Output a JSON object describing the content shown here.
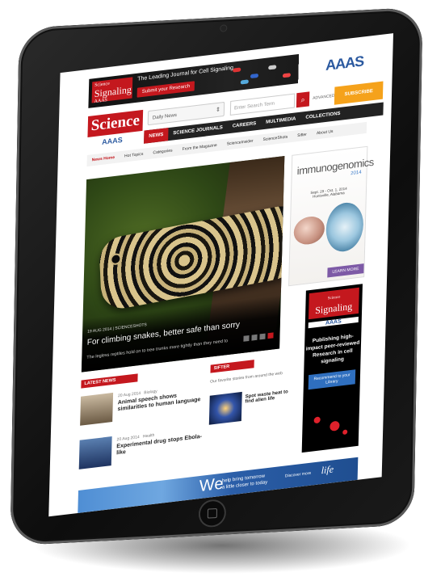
{
  "ad_top": {
    "logo_small": "Science",
    "logo": "Signaling",
    "logo_aaas": "AAAS",
    "tagline": "The Leading Journal for Cell Signaling",
    "submit": "Submit your Research",
    "brand": "AAAS"
  },
  "header": {
    "logo": "Science",
    "dropdown": "Daily News",
    "search_placeholder": "Enter Search Term",
    "advanced": "ADVANCED",
    "subscribe": "SUBSCRIBE",
    "aaas": "AAAS"
  },
  "nav": [
    "NEWS",
    "SCIENCE JOURNALS",
    "CAREERS",
    "MULTIMEDIA",
    "COLLECTIONS"
  ],
  "subnav": [
    "News Home",
    "Hot Topics",
    "Categories",
    "From the Magazine",
    "ScienceInsider",
    "ScienceShots",
    "Sifter",
    "About Us"
  ],
  "hero": {
    "date": "19 AUG 2014",
    "section": "SCIENCESHOTS",
    "title": "For climbing snakes, better safe than sorry",
    "subtitle": "The legless reptiles hold on to tree trunks more tightly than they need to"
  },
  "ad_immuno": {
    "title": "immunogenomics",
    "year": "2014",
    "dates": "Sept. 29 - Oct. 1, 2014",
    "place": "Huntsville, Alabama",
    "learn": "LEARN MORE"
  },
  "ad_signaling": {
    "small": "Science",
    "title": "Signaling",
    "aaas": "AAAS",
    "body": "Publishing high-impact peer-reviewed Research in cell signaling",
    "button": "Recommend to your Library"
  },
  "latest_news": {
    "header": "LATEST NEWS",
    "items": [
      {
        "date": "20 Aug 2014",
        "category": "Biology",
        "title": "Animal speech shows similarities to human language"
      },
      {
        "date": "20 Aug 2014",
        "category": "Health",
        "title": "Experimental drug stops Ebola-like"
      }
    ]
  },
  "sifter": {
    "header": "SIFTER",
    "intro": "Our favorite stories from around the web",
    "item_title": "Spot waste heat to find alien life"
  },
  "bottom_ad": {
    "we": "We",
    "tagline_line1": "help bring tomorrow",
    "tagline_line2": "a little closer to today",
    "small": "Discover more",
    "brand": "life"
  }
}
